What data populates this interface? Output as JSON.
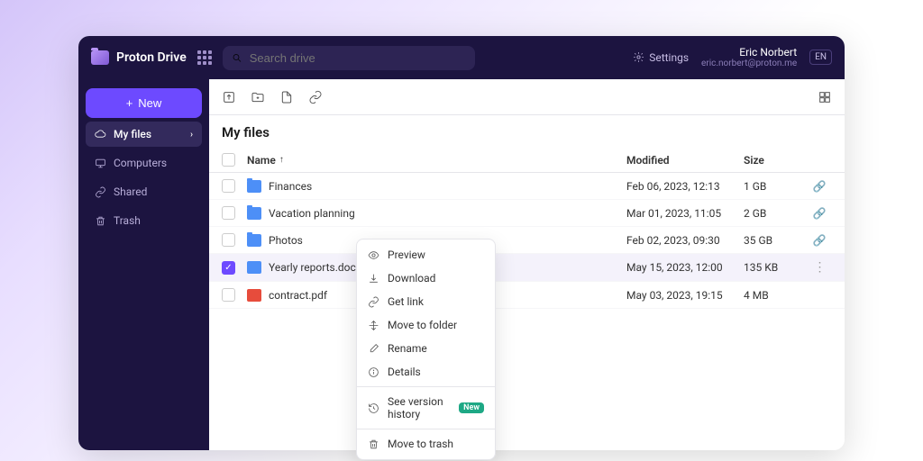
{
  "brand": "Proton Drive",
  "search": {
    "placeholder": "Search drive"
  },
  "header": {
    "settings": "Settings",
    "user_name": "Eric Norbert",
    "user_email": "eric.norbert@proton.me",
    "lang": "EN"
  },
  "sidebar": {
    "new_label": "New",
    "items": [
      {
        "label": "My files",
        "active": true
      },
      {
        "label": "Computers"
      },
      {
        "label": "Shared"
      },
      {
        "label": "Trash"
      }
    ]
  },
  "section_title": "My files",
  "columns": {
    "name": "Name",
    "modified": "Modified",
    "size": "Size"
  },
  "files": [
    {
      "name": "Finances",
      "type": "folder",
      "modified": "Feb 06, 2023, 12:13",
      "size": "1 GB",
      "shared": true
    },
    {
      "name": "Vacation planning",
      "type": "folder",
      "modified": "Mar 01, 2023, 11:05",
      "size": "2 GB",
      "shared": true
    },
    {
      "name": "Photos",
      "type": "folder",
      "modified": "Feb 02, 2023, 09:30",
      "size": "35 GB",
      "shared": true
    },
    {
      "name": "Yearly reports.docx",
      "type": "doc",
      "modified": "May 15, 2023, 12:00",
      "size": "135 KB",
      "selected": true
    },
    {
      "name": "contract.pdf",
      "type": "pdf",
      "modified": "May 03, 2023, 19:15",
      "size": "4 MB"
    }
  ],
  "context_menu": {
    "preview": "Preview",
    "download": "Download",
    "get_link": "Get link",
    "move": "Move to folder",
    "rename": "Rename",
    "details": "Details",
    "history": "See version history",
    "history_badge": "New",
    "trash": "Move to trash"
  }
}
